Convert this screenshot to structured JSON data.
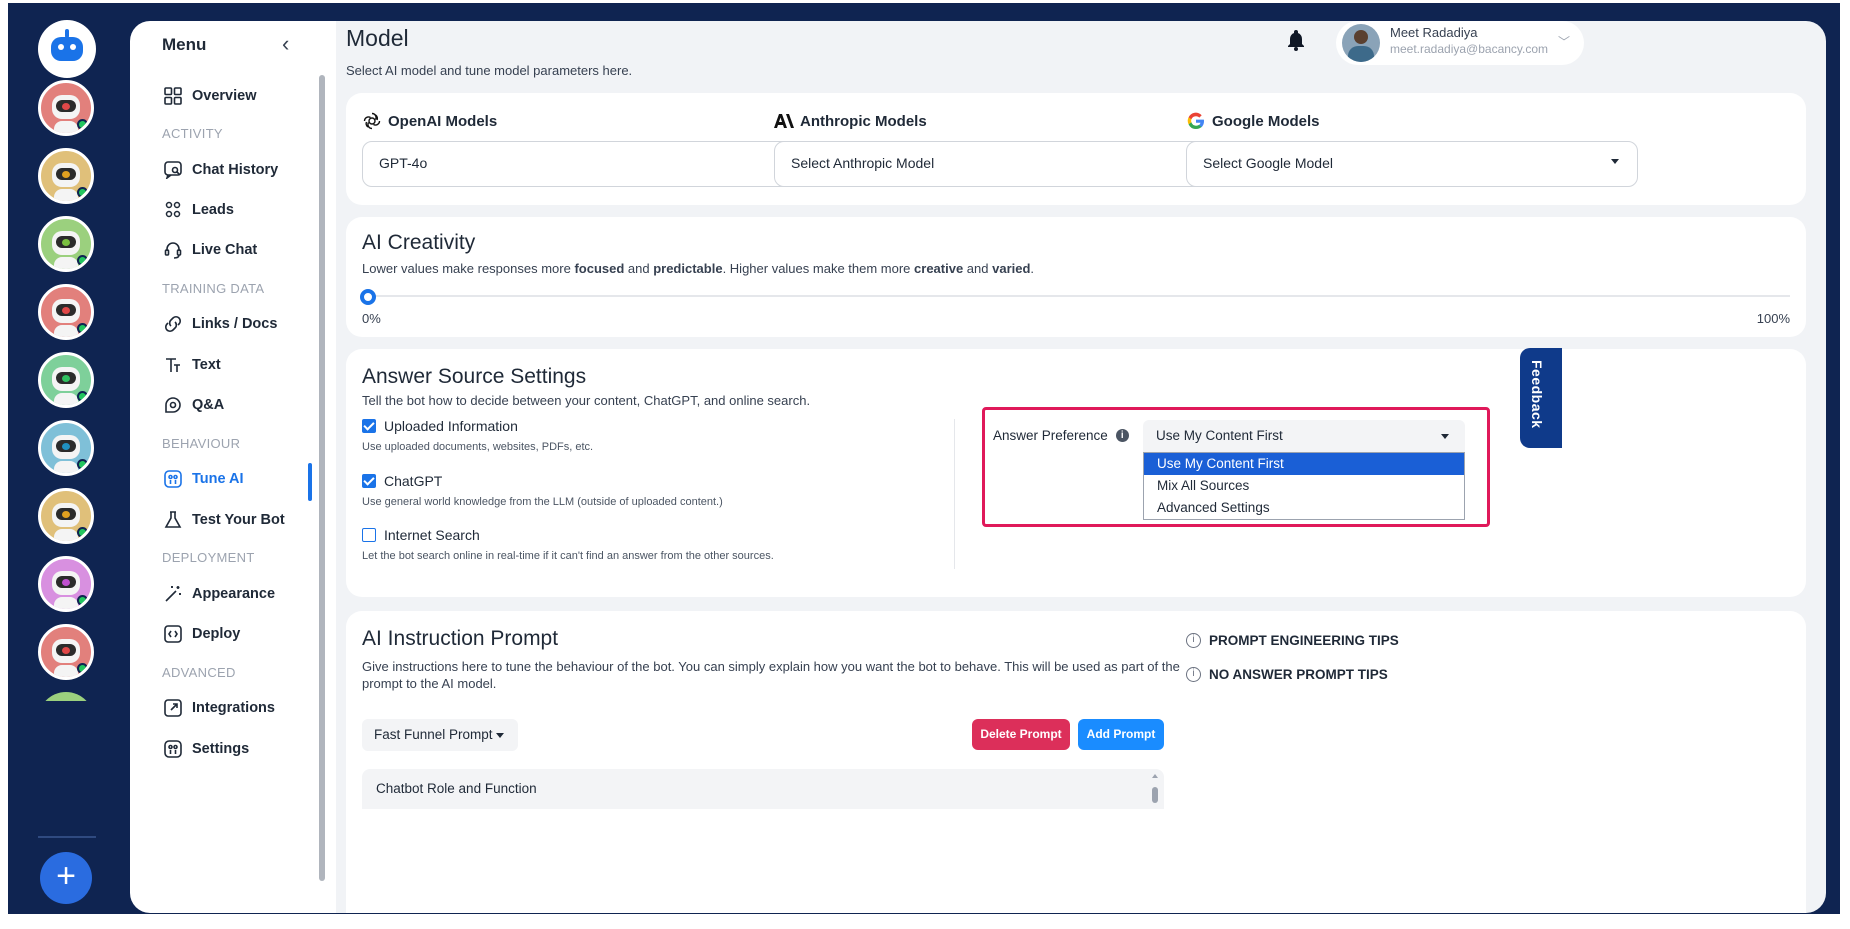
{
  "app": {
    "add_bot_label": "+"
  },
  "menu": {
    "title": "Menu",
    "items": [
      {
        "label": "Overview"
      },
      {
        "label": "ACTIVITY"
      },
      {
        "label": "Chat History"
      },
      {
        "label": "Leads"
      },
      {
        "label": "Live Chat"
      },
      {
        "label": "TRAINING DATA"
      },
      {
        "label": "Links / Docs"
      },
      {
        "label": "Text"
      },
      {
        "label": "Q&A"
      },
      {
        "label": "BEHAVIOUR"
      },
      {
        "label": "Tune AI"
      },
      {
        "label": "Test Your Bot"
      },
      {
        "label": "DEPLOYMENT"
      },
      {
        "label": "Appearance"
      },
      {
        "label": "Deploy"
      },
      {
        "label": "ADVANCED"
      },
      {
        "label": "Integrations"
      },
      {
        "label": "Settings"
      }
    ]
  },
  "header": {
    "title": "Model",
    "subtitle": "Select AI model and tune model parameters here.",
    "user_name": "Meet Radadiya",
    "user_email": "meet.radadiya@bacancy.com"
  },
  "models": {
    "openai_label": "OpenAI Models",
    "openai_value": "GPT-4o",
    "anthropic_label": "Anthropic Models",
    "anthropic_value": "Select Anthropic Model",
    "google_label": "Google Models",
    "google_value": "Select Google Model"
  },
  "creativity": {
    "title": "AI Creativity",
    "desc_1": "Lower values make responses more ",
    "desc_b1": "focused",
    "desc_2": " and ",
    "desc_b2": "predictable",
    "desc_3": ". Higher values make them more ",
    "desc_b3": "creative",
    "desc_4": " and ",
    "desc_b4": "varied",
    "desc_5": ".",
    "min_label": "0%",
    "max_label": "100%",
    "value": 0
  },
  "answer_source": {
    "title": "Answer Source Settings",
    "desc": "Tell the bot how to decide between your content, ChatGPT, and online search.",
    "options": [
      {
        "label": "Uploaded Information",
        "desc": "Use uploaded documents, websites, PDFs, etc.",
        "checked": true
      },
      {
        "label": "ChatGPT",
        "desc": "Use general world knowledge from the LLM (outside of uploaded content.)",
        "checked": true
      },
      {
        "label": "Internet Search",
        "desc": "Let the bot search online in real-time if it can't find an answer from the other sources.",
        "checked": false
      }
    ],
    "preference_label": "Answer Preference",
    "preference_value": "Use My Content First",
    "preference_options": [
      "Use My Content First",
      "Mix All Sources",
      "Advanced Settings"
    ]
  },
  "prompt": {
    "title": "AI Instruction Prompt",
    "desc_line1": "Give instructions here to tune the behaviour of the bot. You can simply explain how you want the bot to behave. This will be used as part of the",
    "desc_line2": "prompt to the AI model.",
    "tips": [
      "PROMPT ENGINEERING TIPS",
      "NO ANSWER PROMPT TIPS"
    ],
    "selected_prompt": "Fast Funnel Prompt",
    "delete_label": "Delete Prompt",
    "add_label": "Add Prompt",
    "textarea_text": "Chatbot Role and Function"
  },
  "feedback": {
    "label": "Feedback"
  },
  "colors": {
    "accent": "#1a73e8",
    "rail": "#0f2451",
    "highlight": "#e0195a",
    "danger": "#dc2f5a"
  }
}
